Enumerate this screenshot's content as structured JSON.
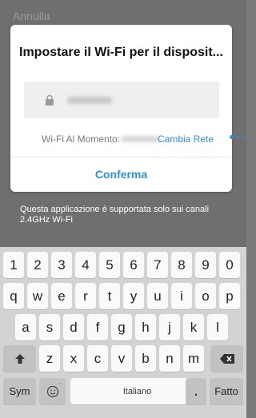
{
  "top": {
    "cancel_label": "Annulla"
  },
  "dialog": {
    "title": "Impostare il Wi-Fi per il disposit...",
    "wifi_label": "Wi-Fi Al Momento:",
    "change_network_label": "Cambia Rete",
    "confirm_label": "Conferma"
  },
  "note": {
    "text": "Questa applicazione è supportata solo sui canali 2.4GHz Wi-Fi"
  },
  "keyboard": {
    "row_numbers": [
      "1",
      "2",
      "3",
      "4",
      "5",
      "6",
      "7",
      "8",
      "9",
      "0"
    ],
    "row1": [
      "q",
      "w",
      "e",
      "r",
      "t",
      "y",
      "u",
      "i",
      "o",
      "p"
    ],
    "row2": [
      "a",
      "s",
      "d",
      "f",
      "g",
      "h",
      "j",
      "k",
      "l"
    ],
    "row3": [
      "z",
      "x",
      "c",
      "v",
      "b",
      "n",
      "m"
    ],
    "sym_label": "Sym",
    "space_label": "Italiano",
    "done_label": "Fatto",
    "icons": {
      "shift": "shift-arrow",
      "backspace": "backspace",
      "emoji": "emoji-face",
      "period": "."
    }
  },
  "colors": {
    "accent": "#2f8fd4",
    "overlay": "#6f6f6f"
  }
}
